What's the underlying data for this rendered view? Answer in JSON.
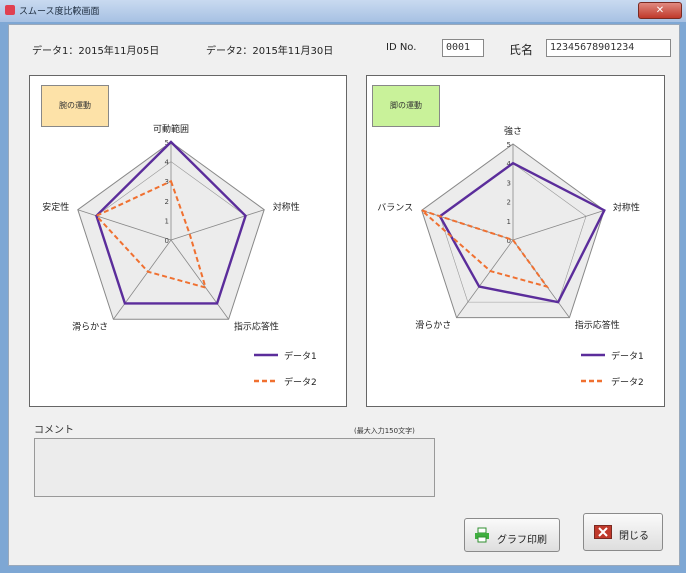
{
  "window": {
    "title": "スムース度比較画面",
    "close_glyph": "✕"
  },
  "header": {
    "data1": "データ1：2015年11月05日",
    "data2": "データ2：2015年11月30日",
    "id_label": "ID No.",
    "id_value": "0001",
    "name_label": "氏名",
    "name_value": "12345678901234"
  },
  "legend": {
    "series1": "データ1",
    "series2": "データ2"
  },
  "comment": {
    "label": "コメント",
    "hint": "(最大入力150文字)",
    "value": ""
  },
  "buttons": {
    "print": "グラフ印刷",
    "close": "閉じる"
  },
  "colors": {
    "series1": "#5b2d9b",
    "series2": "#f07030",
    "tag_left": "#fde2a8",
    "tag_right": "#c9f29a"
  },
  "chart_data": [
    {
      "type": "radar",
      "title": "腕の運動",
      "axes": [
        "可動範囲",
        "対称性",
        "指示応答性",
        "滑らかさ",
        "安定性"
      ],
      "rlim": [
        0,
        5
      ],
      "ticks": [
        "0",
        "1",
        "2",
        "3",
        "4",
        "5"
      ],
      "series": [
        {
          "name": "データ1",
          "values": [
            5,
            4,
            4,
            4,
            4
          ]
        },
        {
          "name": "データ2",
          "values": [
            3,
            1,
            3,
            2,
            4
          ]
        }
      ]
    },
    {
      "type": "radar",
      "title": "脚の運動",
      "axes": [
        "強さ",
        "対称性",
        "指示応答性",
        "滑らかさ",
        "バランス"
      ],
      "rlim": [
        0,
        5
      ],
      "ticks": [
        "0",
        "1",
        "2",
        "3",
        "4",
        "5"
      ],
      "series": [
        {
          "name": "データ1",
          "values": [
            4,
            5,
            4,
            3,
            4
          ]
        },
        {
          "name": "データ2",
          "values": [
            0,
            0,
            3,
            2,
            5
          ]
        }
      ]
    }
  ]
}
